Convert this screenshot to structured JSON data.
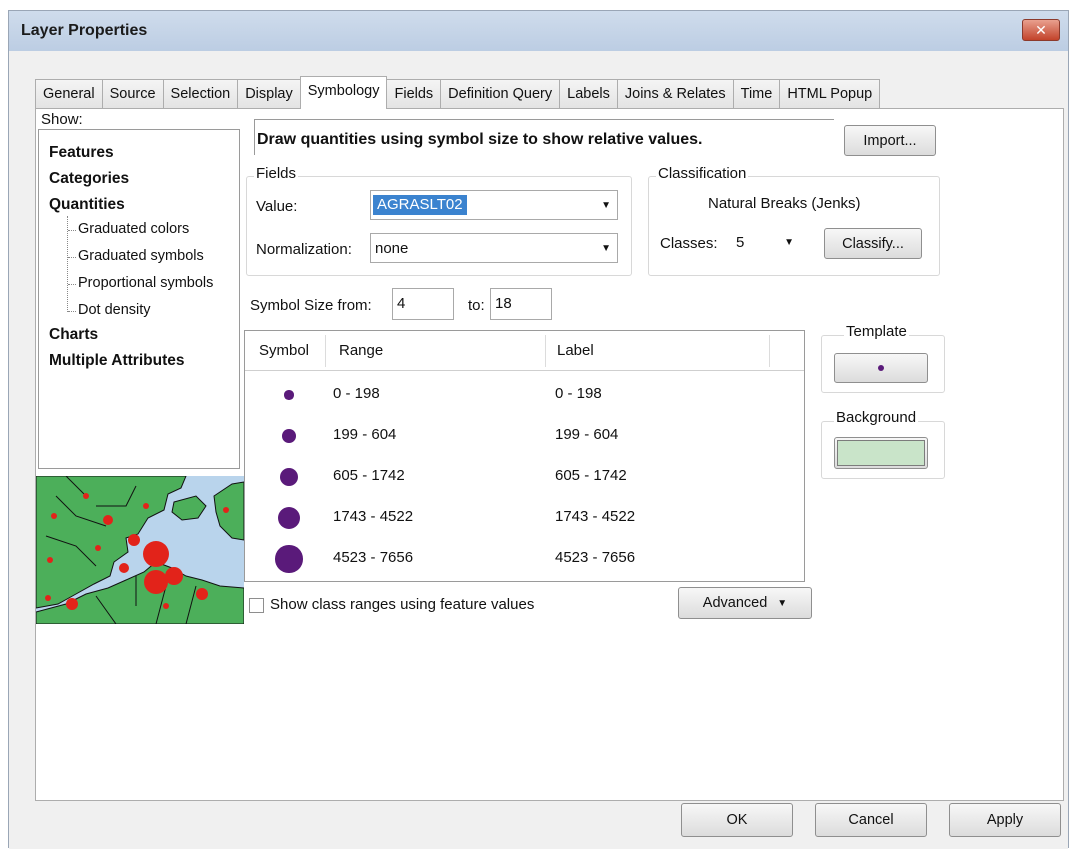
{
  "window": {
    "title": "Layer Properties",
    "close_glyph": "✕"
  },
  "tabs": [
    {
      "label": "General"
    },
    {
      "label": "Source"
    },
    {
      "label": "Selection"
    },
    {
      "label": "Display"
    },
    {
      "label": "Symbology",
      "active": true
    },
    {
      "label": "Fields"
    },
    {
      "label": "Definition Query"
    },
    {
      "label": "Labels"
    },
    {
      "label": "Joins & Relates"
    },
    {
      "label": "Time"
    },
    {
      "label": "HTML Popup"
    }
  ],
  "show": {
    "label": "Show:",
    "items": {
      "features": "Features",
      "categories": "Categories",
      "quantities": "Quantities",
      "graduated_colors": "Graduated colors",
      "graduated_symbols": "Graduated symbols",
      "proportional_symbols": "Proportional symbols",
      "dot_density": "Dot density",
      "charts": "Charts",
      "multiple_attributes": "Multiple Attributes"
    }
  },
  "description": "Draw quantities using symbol size to show relative values.",
  "import_label": "Import...",
  "fields": {
    "title": "Fields",
    "value_label": "Value:",
    "value": "AGRASLT02",
    "normalization_label": "Normalization:",
    "normalization": "none"
  },
  "classification": {
    "title": "Classification",
    "method": "Natural Breaks (Jenks)",
    "classes_label": "Classes:",
    "classes": "5",
    "classify_label": "Classify..."
  },
  "symbol_size": {
    "from_label": "Symbol Size from:",
    "from": "4",
    "to_label": "to:",
    "to": "18"
  },
  "table": {
    "headers": {
      "symbol": "Symbol",
      "range": "Range",
      "label": "Label"
    },
    "symbol_color": "#5a1a7a",
    "rows": [
      {
        "range": "0 - 198",
        "label": "0 - 198",
        "size": 4
      },
      {
        "range": "199 - 604",
        "label": "199 - 604",
        "size": 7.5
      },
      {
        "range": "605 - 1742",
        "label": "605 - 1742",
        "size": 11
      },
      {
        "range": "1743 - 4522",
        "label": "1743 - 4522",
        "size": 14.5
      },
      {
        "range": "4523 - 7656",
        "label": "4523 - 7656",
        "size": 18
      }
    ]
  },
  "template": {
    "title": "Template"
  },
  "background": {
    "title": "Background",
    "color": "#c9e4c9"
  },
  "show_ranges_label": "Show class ranges using feature values",
  "advanced_label": "Advanced",
  "footer": {
    "ok": "OK",
    "cancel": "Cancel",
    "apply": "Apply"
  }
}
